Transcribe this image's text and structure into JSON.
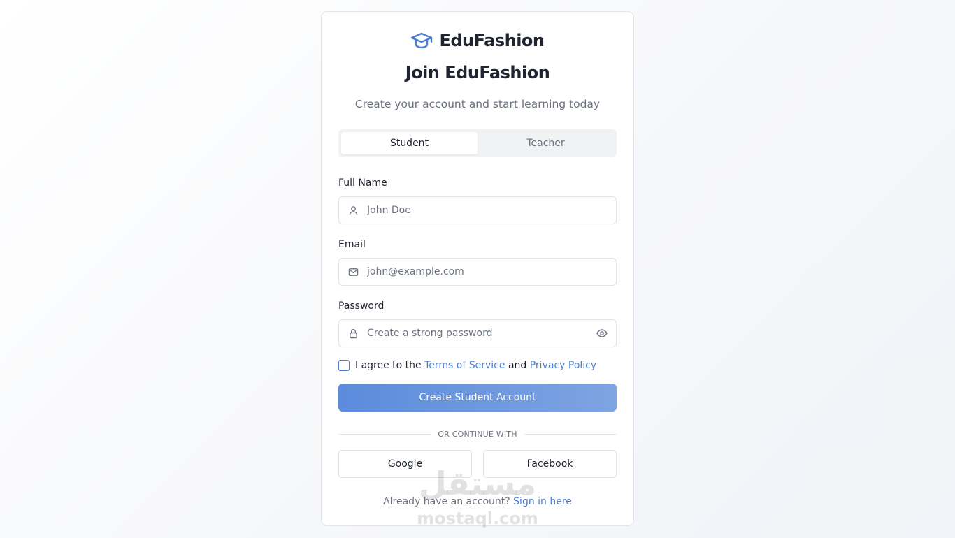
{
  "brand": {
    "name": "EduFashion",
    "icon": "graduation-cap-icon",
    "accent": "#4a7fd4"
  },
  "heading": {
    "title": "Join EduFashion",
    "subtitle": "Create your account and start learning today"
  },
  "tabs": [
    {
      "label": "Student",
      "active": true
    },
    {
      "label": "Teacher",
      "active": false
    }
  ],
  "form": {
    "full_name": {
      "label": "Full Name",
      "placeholder": "John Doe",
      "icon": "user-icon",
      "value": ""
    },
    "email": {
      "label": "Email",
      "placeholder": "john@example.com",
      "icon": "mail-icon",
      "value": ""
    },
    "password": {
      "label": "Password",
      "placeholder": "Create a strong password",
      "icon": "lock-icon",
      "toggle_icon": "eye-icon",
      "value": ""
    },
    "agree": {
      "checked": false,
      "prefix": "I agree to the",
      "terms_link": "Terms of Service",
      "conjunction": "and",
      "privacy_link": "Privacy Policy"
    },
    "submit_label": "Create Student Account"
  },
  "divider_text": "OR CONTINUE WITH",
  "social": {
    "google_label": "Google",
    "facebook_label": "Facebook"
  },
  "footer": {
    "text": "Already have an account?",
    "link": "Sign in here"
  },
  "watermark": {
    "arabic": "مستقل",
    "latin": "mostaql.com"
  }
}
